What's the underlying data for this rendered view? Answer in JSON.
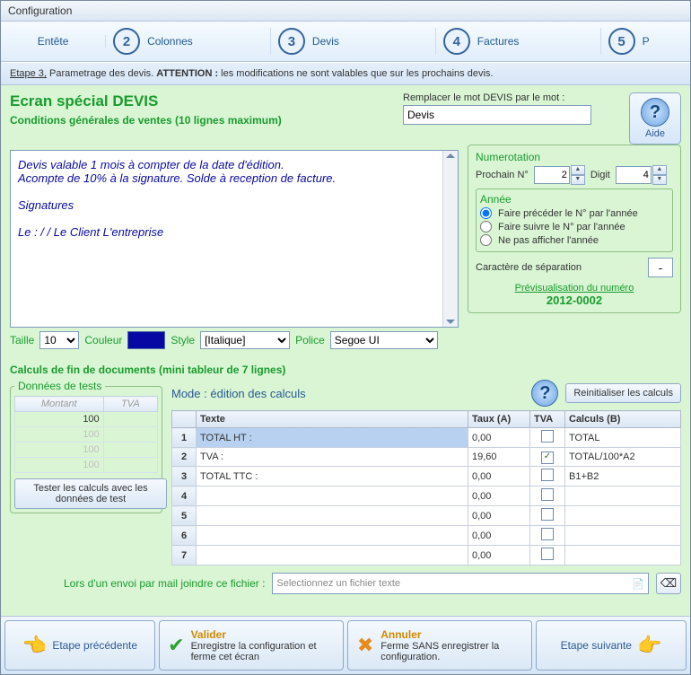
{
  "window": {
    "title": "Configuration"
  },
  "wizard": {
    "steps": [
      {
        "num": "",
        "label": "Entête"
      },
      {
        "num": "2",
        "label": "Colonnes"
      },
      {
        "num": "3",
        "label": "Devis"
      },
      {
        "num": "4",
        "label": "Factures"
      },
      {
        "num": "5",
        "label": "P"
      }
    ],
    "attention": {
      "prefix": "Etape 3,",
      "mid": " Parametrage des devis. ",
      "bold": "ATTENTION :",
      "rest": " les modifications ne sont valables que sur les prochains devis."
    }
  },
  "screen_title": "Ecran spécial DEVIS",
  "replace": {
    "label": "Remplacer le mot DEVIS par le mot :",
    "value": "Devis"
  },
  "help": {
    "label": "Aide"
  },
  "conditions": {
    "title": "Conditions générales de ventes (10 lignes maximum)",
    "text": "Devis valable 1 mois à compter de la date d'édition.\nAcompte de 10% à la signature. Solde à reception de facture.\n\n                                         Signatures\n\nLe :    /    /                Le Client                                      L'entreprise"
  },
  "format": {
    "taille_label": "Taille",
    "taille": "10",
    "couleur_label": "Couleur",
    "style_label": "Style",
    "style": "[Italique]",
    "police_label": "Police",
    "police": "Segoe UI"
  },
  "numerotation": {
    "legend": "Numerotation",
    "prochain_label": "Prochain N°",
    "prochain": "2",
    "digit_label": "Digit",
    "digit": "4",
    "annee_label": "Année",
    "opt1": "Faire précéder le N° par l'année",
    "opt2": "Faire suivre le N° par l'année",
    "opt3": "Ne pas afficher l'année",
    "sep_label": "Caractère de séparation",
    "sep": "-",
    "preview_label": "Prévisualisation du numéro",
    "preview_value": "2012-0002"
  },
  "calculs": {
    "title": "Calculs de fin de documents (mini tableur de 7 lignes)",
    "tests_legend": "Données de tests",
    "tests_headers": [
      "Montant",
      "TVA"
    ],
    "tests_rows": [
      [
        "100",
        ""
      ],
      [
        "100",
        ""
      ],
      [
        "100",
        ""
      ],
      [
        "100",
        ""
      ]
    ],
    "test_btn": "Tester les calculs avec les données de test",
    "mode_label": "Mode : édition des calculs",
    "reset_btn": "Reinitialiser les calculs",
    "headers": {
      "texte": "Texte",
      "taux": "Taux (A)",
      "tva": "TVA",
      "calc": "Calculs (B)"
    },
    "rows": [
      {
        "n": "1",
        "texte": "TOTAL HT :",
        "taux": "0,00",
        "tva": false,
        "calc": "TOTAL"
      },
      {
        "n": "2",
        "texte": "TVA :",
        "taux": "19,60",
        "tva": true,
        "calc": "TOTAL/100*A2"
      },
      {
        "n": "3",
        "texte": "TOTAL TTC :",
        "taux": "0,00",
        "tva": false,
        "calc": "B1+B2"
      },
      {
        "n": "4",
        "texte": "",
        "taux": "0,00",
        "tva": false,
        "calc": ""
      },
      {
        "n": "5",
        "texte": "",
        "taux": "0,00",
        "tva": false,
        "calc": ""
      },
      {
        "n": "6",
        "texte": "",
        "taux": "0,00",
        "tva": false,
        "calc": ""
      },
      {
        "n": "7",
        "texte": "",
        "taux": "0,00",
        "tva": false,
        "calc": ""
      }
    ]
  },
  "mail": {
    "label": "Lors d'un envoi par mail joindre ce fichier :",
    "placeholder": "Selectionnez un fichier texte"
  },
  "footer": {
    "prev": "Etape précédente",
    "valider": {
      "title": "Valider",
      "sub": "Enregistre la configuration et ferme cet écran"
    },
    "annuler": {
      "title": "Annuler",
      "sub": "Ferme SANS enregistrer la configuration."
    },
    "next": "Etape suivante"
  }
}
